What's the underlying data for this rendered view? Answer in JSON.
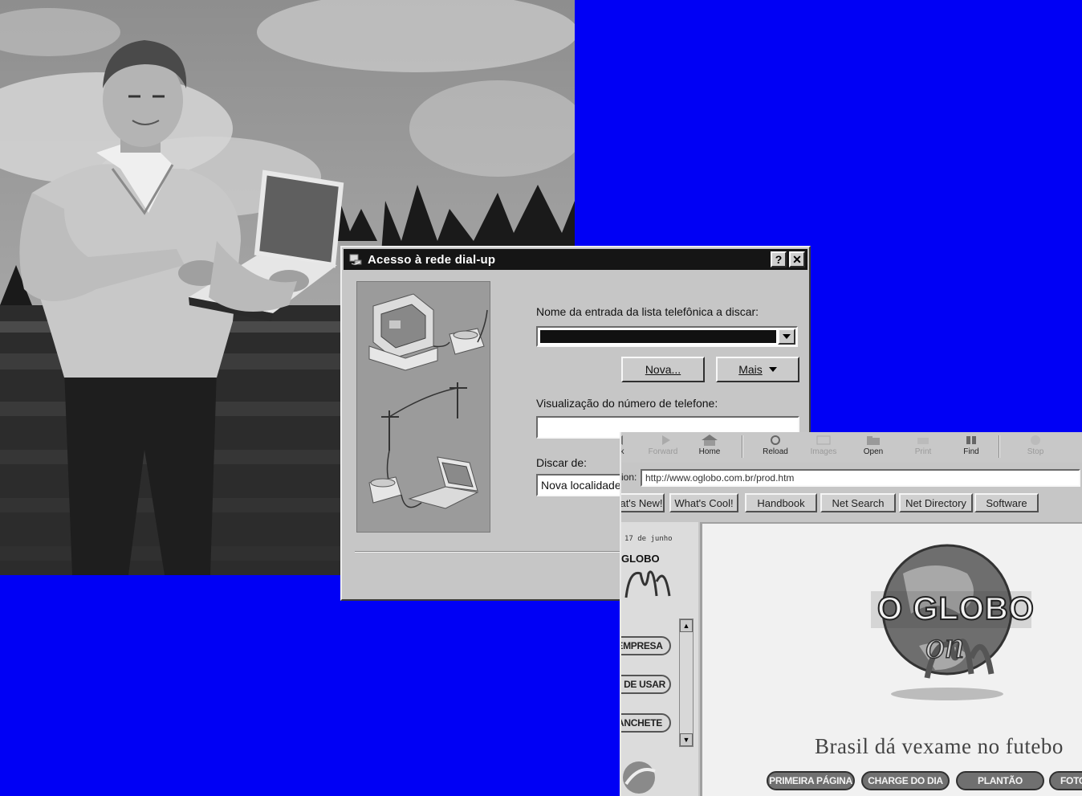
{
  "colors": {
    "background": "#0000f5",
    "titlebar": "#151515",
    "window": "#c6c6c6"
  },
  "dialup_dialog": {
    "title": "Acesso à rede dial-up",
    "help_button": "?",
    "close_button": "✕",
    "entry_label": "Nome da entrada da lista telefônica a discar:",
    "entry_value": "",
    "new_button": "Nova...",
    "more_button": "Mais",
    "phone_preview_label": "Visualização do número de telefone:",
    "phone_preview_value": "",
    "dial_from_label": "Discar de:",
    "dial_from_value": "Nova localidade"
  },
  "browser": {
    "toolbar": [
      {
        "label": "k",
        "icon": "back-icon",
        "enabled": true
      },
      {
        "label": "Forward",
        "icon": "forward-icon",
        "enabled": false
      },
      {
        "label": "Home",
        "icon": "home-icon",
        "enabled": true
      },
      {
        "label": "Reload",
        "icon": "reload-icon",
        "enabled": true
      },
      {
        "label": "Images",
        "icon": "images-icon",
        "enabled": false
      },
      {
        "label": "Open",
        "icon": "open-icon",
        "enabled": true
      },
      {
        "label": "Print",
        "icon": "print-icon",
        "enabled": false
      },
      {
        "label": "Find",
        "icon": "find-icon",
        "enabled": true
      },
      {
        "label": "Stop",
        "icon": "stop-icon",
        "enabled": false
      }
    ],
    "location_label": "ion:",
    "url": "http://www.oglobo.com.br/prod.htm",
    "directory_buttons": [
      "at's New!",
      "What's Cool!",
      "Handbook",
      "Net Search",
      "Net Directory",
      "Software"
    ],
    "left_frame": {
      "date": "17 de junho",
      "logo": "GLOBO",
      "nav_items": [
        "EMPRESA",
        "O DE USAR",
        "ANCHETE"
      ]
    },
    "main": {
      "logo": "O GLOBO",
      "logo_script": "on",
      "headline": "Brasil dá vexame no futebo",
      "nav_buttons": [
        "PRIMEIRA PÁGINA",
        "CHARGE DO DIA",
        "PLANTÃO",
        "FOTO"
      ]
    }
  }
}
